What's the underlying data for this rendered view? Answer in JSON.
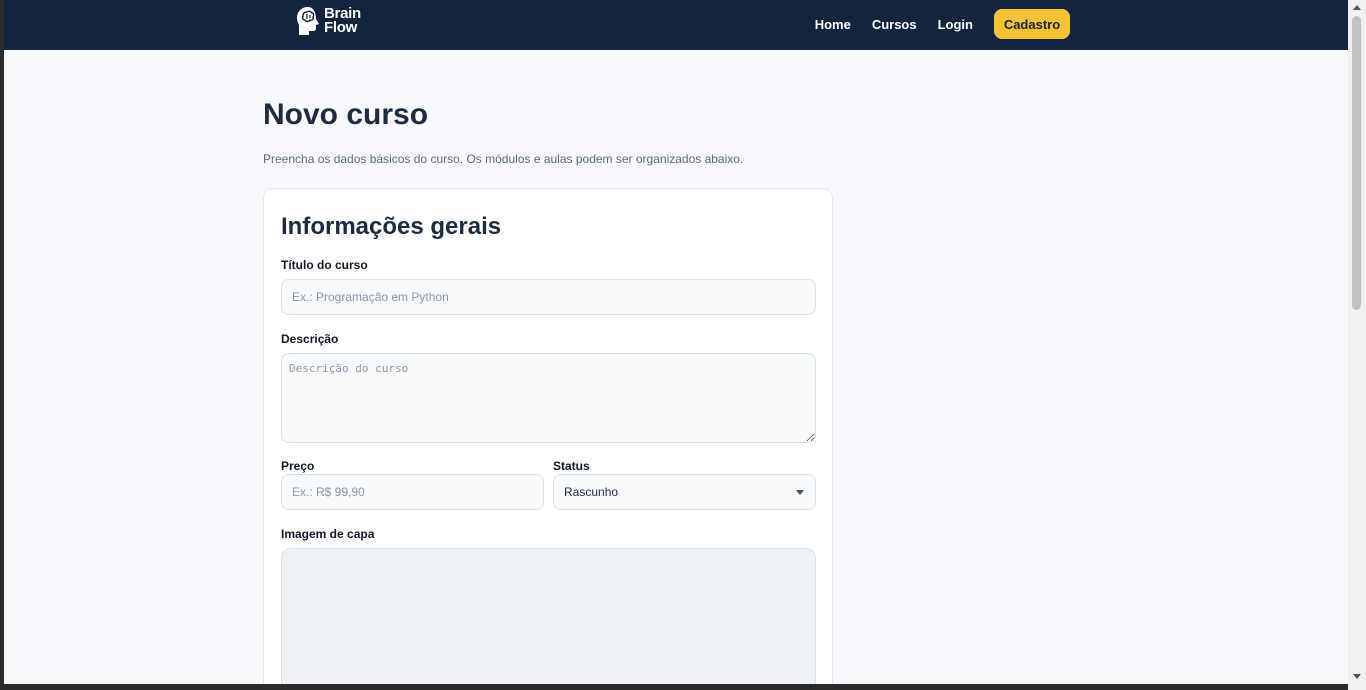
{
  "brand": {
    "line1": "Brain",
    "line2": "Flow",
    "logo_icon": "brain-head-icon"
  },
  "nav": {
    "links": [
      "Home",
      "Cursos",
      "Login"
    ],
    "cta": "Cadastro"
  },
  "page": {
    "title": "Novo curso",
    "subtitle": "Preencha os dados básicos do curso. Os módulos e aulas podem ser organizados abaixo."
  },
  "form": {
    "section_title": "Informações gerais",
    "title_label": "Título do curso",
    "title_placeholder": "Ex.: Programação em Python",
    "title_value": "",
    "description_label": "Descrição",
    "description_placeholder": "Descrição do curso",
    "description_value": "",
    "price_label": "Preço",
    "price_placeholder": "Ex.: R$ 99,90",
    "price_value": "",
    "status_label": "Status",
    "status_value": "Rascunho",
    "cover_label": "Imagem de capa"
  },
  "colors": {
    "navbar": "#13243f",
    "accent": "#f6c232",
    "page_bg": "#f7f9fc"
  }
}
